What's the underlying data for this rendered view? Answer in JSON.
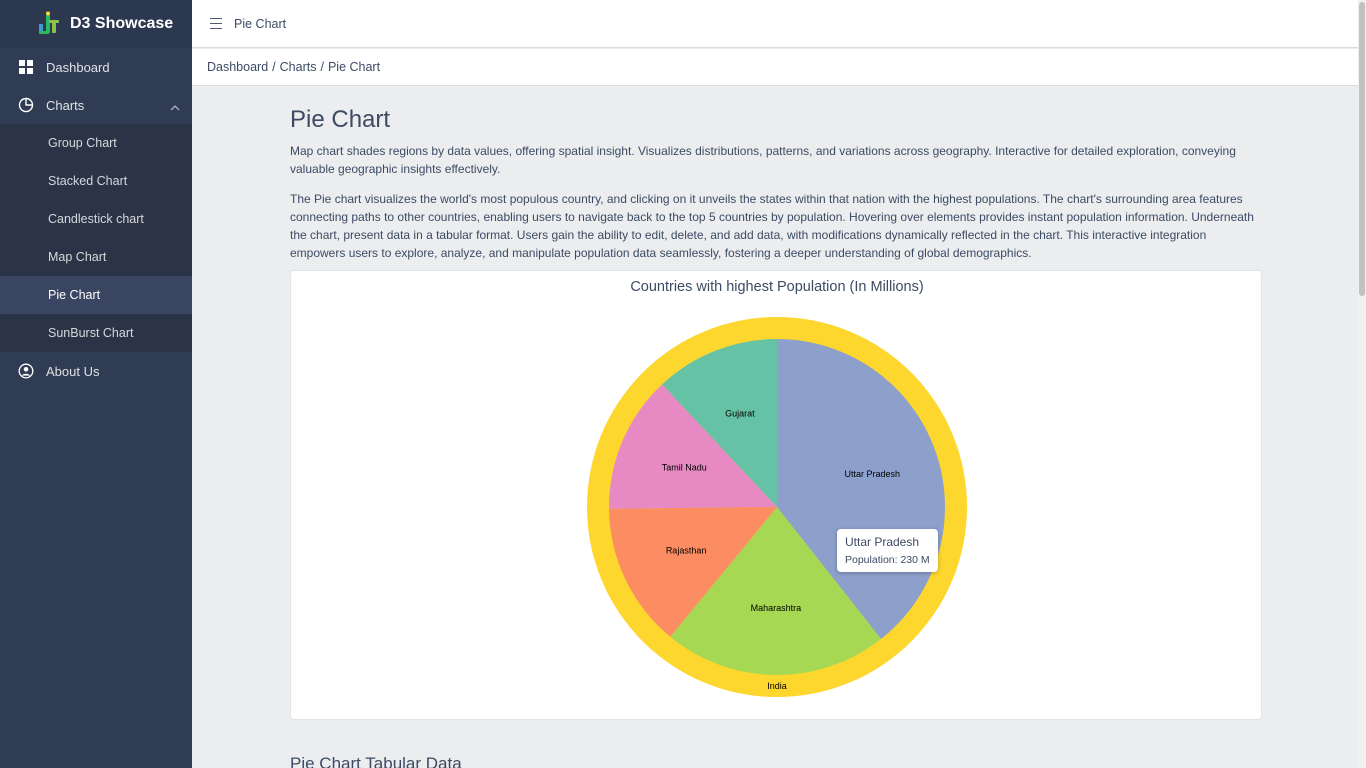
{
  "brand": {
    "name": "D3 Showcase"
  },
  "sidebar": {
    "dashboard": "Dashboard",
    "charts": "Charts",
    "chart_items": [
      "Group Chart",
      "Stacked Chart",
      "Candlestick chart",
      "Map Chart",
      "Pie Chart",
      "SunBurst Chart"
    ],
    "about": "About Us"
  },
  "header": {
    "title": "Pie Chart"
  },
  "breadcrumb": {
    "items": [
      "Dashboard",
      "Charts",
      "Pie Chart"
    ],
    "separator": "/"
  },
  "main": {
    "title": "Pie Chart",
    "description1": "Map chart shades regions by data values, offering spatial insight. Visualizes distributions, patterns, and variations across geography. Interactive for detailed exploration, conveying valuable geographic insights effectively.",
    "description2": "The Pie chart visualizes the world's most populous country, and clicking on it unveils the states within that nation with the highest populations. The chart's surrounding area features connecting paths to other countries, enabling users to navigate back to the top 5 countries by population. Hovering over elements provides instant population information. Underneath the chart, present data in a tabular format. Users gain the ability to edit, delete, and add data, with modifications dynamically reflected in the chart. This interactive integration empowers users to explore, analyze, and manipulate population data seamlessly, fostering a deeper understanding of global demographics.",
    "table_title": "Pie Chart Tabular Data"
  },
  "tooltip": {
    "title": "Uttar Pradesh",
    "text": "Population: 230 M"
  },
  "chart_data": {
    "type": "pie",
    "title": "Countries with highest Population (In Millions)",
    "outer_ring": {
      "label": "India",
      "color": "#fdd62e"
    },
    "slices": [
      {
        "label": "Uttar Pradesh",
        "value": 230,
        "color": "#8da0cb"
      },
      {
        "label": "Maharashtra",
        "value": 126,
        "color": "#a6d854"
      },
      {
        "label": "Rajasthan",
        "value": 81,
        "color": "#fc8d62"
      },
      {
        "label": "Tamil Nadu",
        "value": 77,
        "color": "#e78ac3"
      },
      {
        "label": "Gujarat",
        "value": 70,
        "color": "#66c2a5"
      }
    ]
  },
  "colors": {
    "sidebar": "#303c54",
    "accent": "#2eb85c"
  }
}
